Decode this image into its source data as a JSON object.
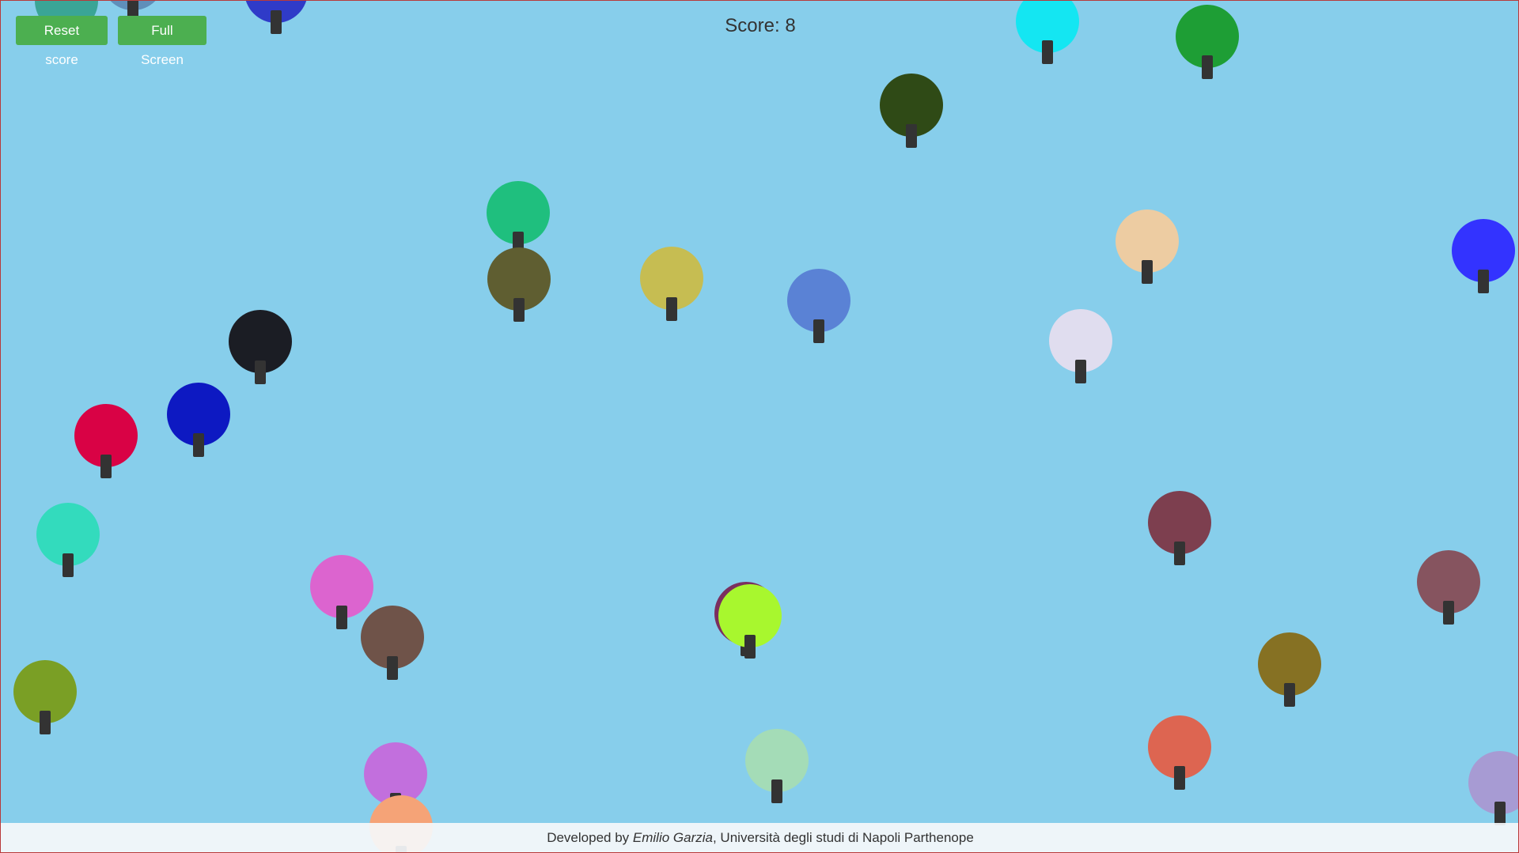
{
  "toolbar": {
    "reset_label": "Reset score",
    "fullscreen_label": "Full Screen"
  },
  "score": {
    "label": "Score: 8"
  },
  "footer": {
    "prefix": "Developed by ",
    "author": "Emilio Garzia",
    "suffix": ", Università degli studi di Napoli Parthenope"
  },
  "colors": {
    "sky": "#87CEEB",
    "button": "#4CAF50",
    "string": "#333333"
  },
  "balloons": [
    {
      "color": "#3aa596"
    },
    {
      "color": "#5f8fba"
    },
    {
      "color": "#2f3bc8"
    },
    {
      "color": "#14e6f2"
    },
    {
      "color": "#1e9e35"
    },
    {
      "color": "#2f4a16"
    },
    {
      "color": "#1fbf7e"
    },
    {
      "color": "#5f5e31"
    },
    {
      "color": "#c6bd52"
    },
    {
      "color": "#5a82d5"
    },
    {
      "color": "#edcca2"
    },
    {
      "color": "#3333ff"
    },
    {
      "color": "#e0ddef"
    },
    {
      "color": "#1b1d24"
    },
    {
      "color": "#0d19c2"
    },
    {
      "color": "#d90245"
    },
    {
      "color": "#33dbbd"
    },
    {
      "color": "#7d3f4f"
    },
    {
      "color": "#86545f"
    },
    {
      "color": "#dc64cf"
    },
    {
      "color": "#6f5349"
    },
    {
      "color": "#7b2f5f"
    },
    {
      "color": "#a8f72e"
    },
    {
      "color": "#7a9f25"
    },
    {
      "color": "#867123"
    },
    {
      "color": "#a4dcb7"
    },
    {
      "color": "#dd6551"
    },
    {
      "color": "#c26fdd"
    },
    {
      "color": "#f5a377"
    },
    {
      "color": "#a79bd3"
    }
  ]
}
